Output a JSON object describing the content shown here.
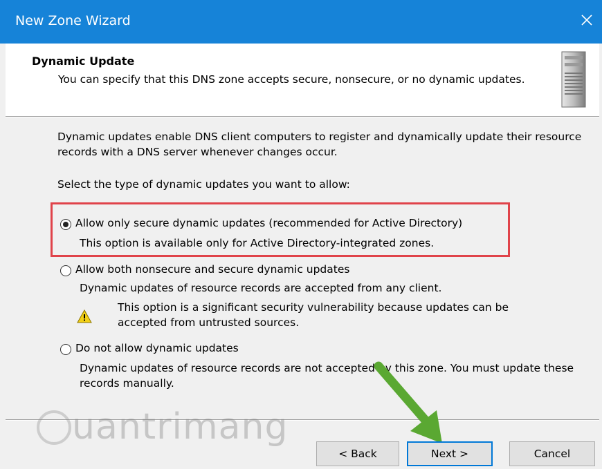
{
  "window": {
    "title": "New Zone Wizard",
    "close_icon": "close-icon"
  },
  "header": {
    "title": "Dynamic Update",
    "description": "You can specify that this DNS zone accepts secure, nonsecure, or no dynamic updates.",
    "icon": "server-icon"
  },
  "content": {
    "intro": "Dynamic updates enable DNS client computers to register and dynamically update their resource records with a DNS server whenever changes occur.",
    "prompt": "Select the type of dynamic updates you want to allow:",
    "options": [
      {
        "label": "Allow only secure dynamic updates (recommended for Active Directory)",
        "description": "This option is available only for Active Directory-integrated zones.",
        "selected": true
      },
      {
        "label": "Allow both nonsecure and secure dynamic updates",
        "description": "Dynamic updates of resource records are accepted from any client.",
        "warning": "This option is a significant security vulnerability because updates can be accepted from untrusted sources.",
        "selected": false
      },
      {
        "label": "Do not allow dynamic updates",
        "description": "Dynamic updates of resource records are not accepted by this zone. You must update these records manually.",
        "selected": false
      }
    ]
  },
  "buttons": {
    "back": "< Back",
    "next": "Next >",
    "cancel": "Cancel"
  },
  "watermark": "uantrimang",
  "colors": {
    "titlebar": "#1683d8",
    "highlight": "#e0434a",
    "arrow": "#5aa832",
    "default_button_border": "#0078d7"
  }
}
